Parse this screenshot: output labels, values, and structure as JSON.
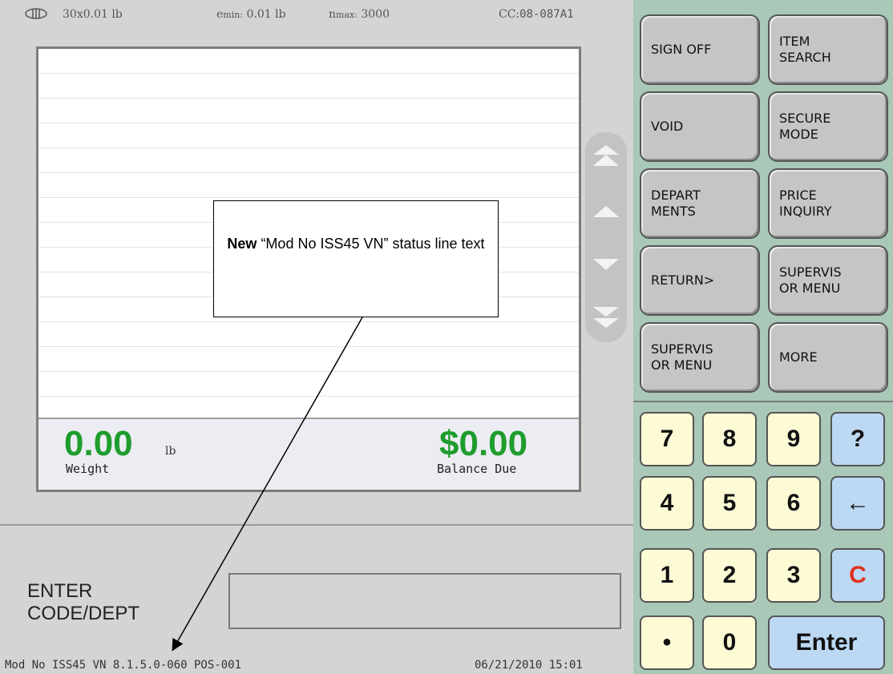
{
  "scale_header": {
    "capacity": "30x0.01 lb",
    "e_min_prefix": "e",
    "e_min_sub": "min:",
    "e_min_value": "0.01 lb",
    "n_max_prefix": "n",
    "n_max_sub": "max:",
    "n_max_value": "3000",
    "cc_label": "CC:",
    "cc_value": "08-087A1"
  },
  "totals": {
    "weight_value": "0.00",
    "weight_unit": "lb",
    "weight_label": "Weight",
    "balance_value": "$0.00",
    "balance_label": "Balance Due"
  },
  "prompt": {
    "label": "ENTER\nCODE/DEPT",
    "entry_value": ""
  },
  "status_bar": {
    "left": "Mod No ISS45 VN 8.1.5.0-060 POS-001",
    "right": "06/21/2010 15:01"
  },
  "function_keys": [
    {
      "label": "SIGN OFF"
    },
    {
      "label": "ITEM\nSEARCH"
    },
    {
      "label": "VOID"
    },
    {
      "label": "SECURE\nMODE"
    },
    {
      "label": "DEPART\nMENTS"
    },
    {
      "label": "PRICE\nINQUIRY"
    },
    {
      "label": "RETURN>"
    },
    {
      "label": "SUPERVIS\nOR MENU"
    },
    {
      "label": "SUPERVIS\nOR MENU"
    },
    {
      "label": "MORE"
    }
  ],
  "keypad": {
    "k7": "7",
    "k8": "8",
    "k9": "9",
    "help": "?",
    "k4": "4",
    "k5": "5",
    "k6": "6",
    "back": "←",
    "k1": "1",
    "k2": "2",
    "k3": "3",
    "clear": "C",
    "dot": "•",
    "k0": "0",
    "enter": "Enter"
  },
  "scroll_icons": [
    "page-up-icon",
    "line-up-icon",
    "line-down-icon",
    "page-down-icon"
  ],
  "annotation": {
    "bold": "New",
    "text": " “Mod No ISS45 VN” status line text"
  },
  "colors": {
    "total_green": "#1e9d2c",
    "keypad_panel": "#a9c8b8",
    "number_key": "#fdfad6",
    "action_key": "#bcd8f3",
    "clear_red": "#e0311f"
  }
}
